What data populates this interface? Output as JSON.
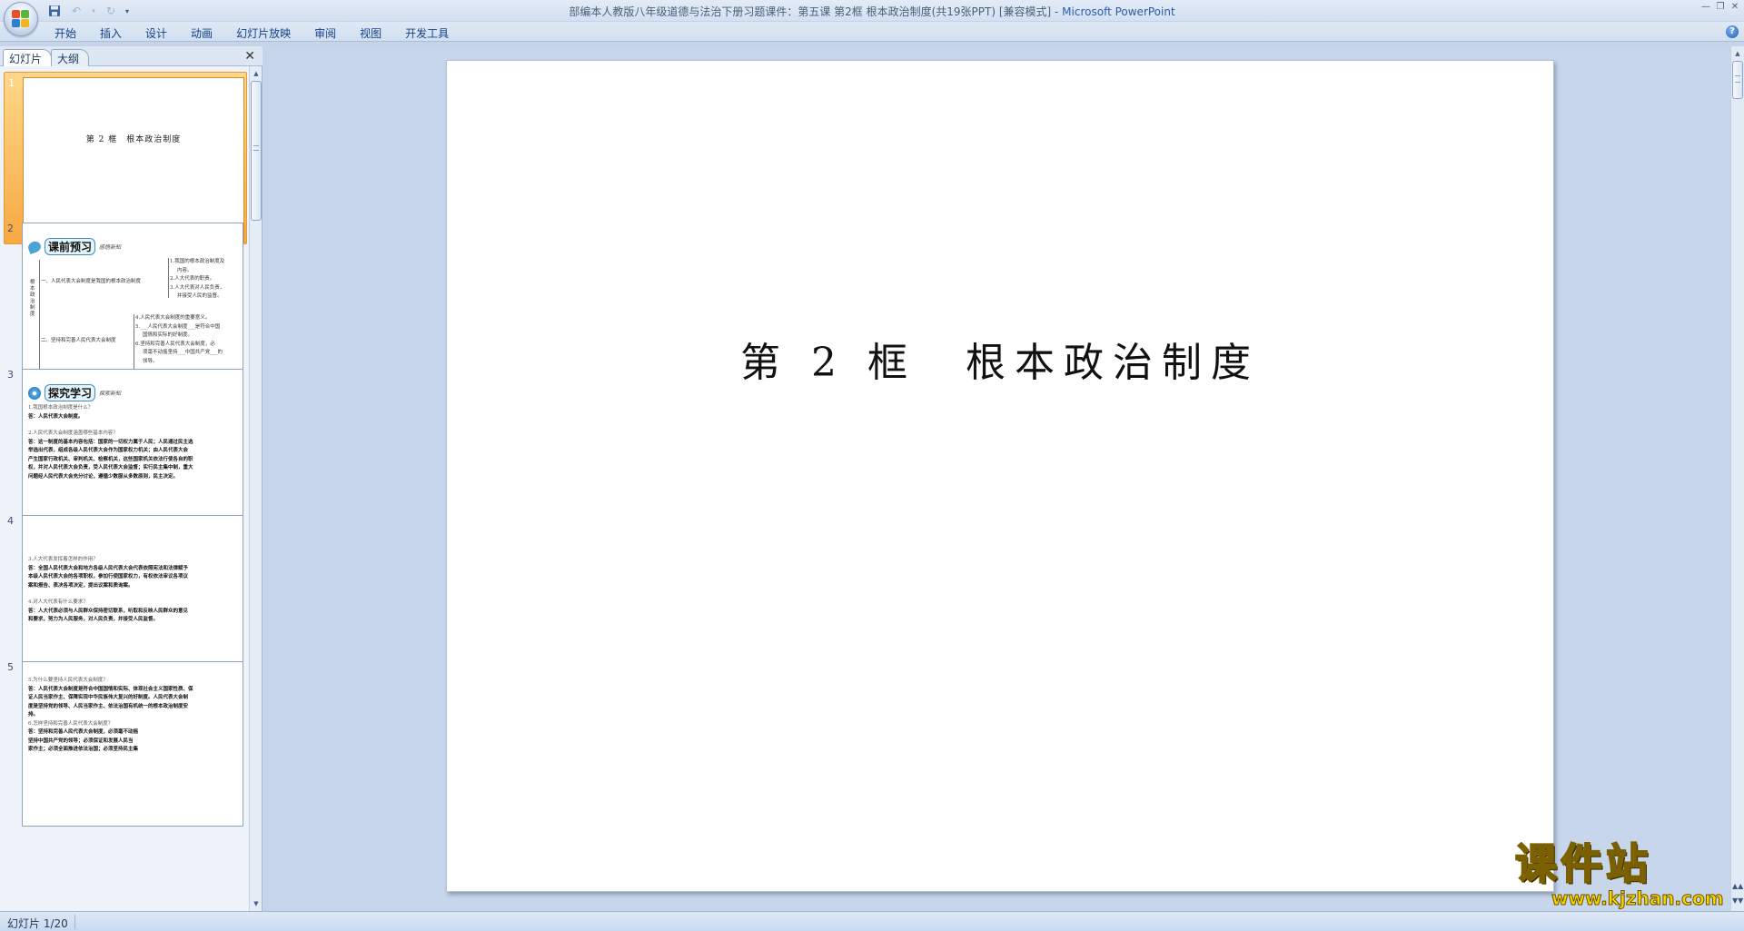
{
  "window": {
    "title": "部编本人教版八年级道德与法治下册习题课件：第五课 第2框 根本政治制度(共19张PPT) [兼容模式]",
    "app_name": "Microsoft PowerPoint",
    "separator": " - "
  },
  "ribbon": {
    "tabs": [
      "开始",
      "插入",
      "设计",
      "动画",
      "幻灯片放映",
      "审阅",
      "视图",
      "开发工具"
    ]
  },
  "pane": {
    "tabs": [
      "幻灯片",
      "大纲"
    ],
    "active_tab": 0
  },
  "thumbnails": [
    {
      "number": "1",
      "title": "第 2 框　根本政治制度"
    },
    {
      "number": "2",
      "header": "课前预习",
      "header_tag": "感悟新知",
      "side_label": "根本政治制度",
      "branches": [
        "一、人民代表大会制度是我国的根本政治制度",
        "二、坚持和完善人民代表大会制度"
      ],
      "items": [
        "1.我国的根本政治制度及",
        "内容。",
        "2.人大代表的职责。",
        "3.人大代表对人民负责，",
        "并接受人民的监督。",
        "4.人民代表大会制度的重要意义。",
        "5.___人民代表大会制度___是符合中国",
        "国情和实际的好制度。",
        "6.坚持和完善人民代表大会制度，必",
        "须毫不动摇坚持___中国共产党___的",
        "领导。"
      ]
    },
    {
      "number": "3",
      "header": "探究学习",
      "header_tag": "探索新知",
      "lines": [
        {
          "kind": "q",
          "text": "1.我国根本政治制度是什么？"
        },
        {
          "kind": "a",
          "text": "答：人民代表大会制度。"
        },
        {
          "kind": "gap",
          "text": ""
        },
        {
          "kind": "q",
          "text": "2.人民代表大会制度涵盖哪些基本内容？"
        },
        {
          "kind": "a",
          "text": "答：这一制度的基本内容包括：国家的一切权力属于人民；人民通过民主选"
        },
        {
          "kind": "a",
          "text": "举选出代表，组成各级人民代表大会作为国家权力机关；由人民代表大会"
        },
        {
          "kind": "a",
          "text": "产生国家行政机关、审判机关、检察机关，这些国家机关依法行使各自的职"
        },
        {
          "kind": "a",
          "text": "权，并对人民代表大会负责，受人民代表大会监督；实行民主集中制，重大"
        },
        {
          "kind": "a",
          "text": "问题经人民代表大会充分讨论，遵循少数服从多数原则，民主决定。"
        }
      ]
    },
    {
      "number": "4",
      "lines": [
        {
          "kind": "q",
          "text": "3.人大代表发挥着怎样的作用？"
        },
        {
          "kind": "a",
          "text": "答：全国人民代表大会和地方各级人民代表大会代表依照宪法和法律赋予"
        },
        {
          "kind": "a",
          "text": "本级人民代表大会的各项职权，参加行使国家权力，有权依法审议各项议"
        },
        {
          "kind": "a",
          "text": "案和报告、表决各项决定，提出议案和质询案。"
        },
        {
          "kind": "gap",
          "text": ""
        },
        {
          "kind": "q",
          "text": "4.对人大代表有什么要求？"
        },
        {
          "kind": "a",
          "text": "答：人大代表必须与人民群众保持密切联系，听取和反映人民群众的意见"
        },
        {
          "kind": "a",
          "text": "和要求，努力为人民服务，对人民负责，并接受人民监督。"
        }
      ]
    },
    {
      "number": "5",
      "lines": [
        {
          "kind": "q",
          "text": "5.为什么要坚持人民代表大会制度？"
        },
        {
          "kind": "a",
          "text": "答：人民代表大会制度是符合中国国情和实际、体现社会主义国家性质、保"
        },
        {
          "kind": "a",
          "text": "证人民当家作主、保障实现中华民族伟大复兴的好制度。人民代表大会制"
        },
        {
          "kind": "a",
          "text": "度是坚持党的领导、人民当家作主、依法治国有机统一的根本政治制度安"
        },
        {
          "kind": "a",
          "text": "排。"
        },
        {
          "kind": "q",
          "text": "6.怎样坚持和完善人民代表大会制度？"
        },
        {
          "kind": "a",
          "text": "答：坚持和完善人民代表大会制度，必须毫不动摇"
        },
        {
          "kind": "a",
          "text": "坚持中国共产党的领导；必须保证和发展人民当"
        },
        {
          "kind": "a",
          "text": "家作主；必须全面推进依法治国；必须坚持民主集"
        }
      ]
    }
  ],
  "slide": {
    "title": "第 2 框　根本政治制度"
  },
  "watermark": {
    "brand": "课件站",
    "url": "www.kjzhan.com"
  },
  "status": {
    "slide_indicator": "幻灯片 1/20"
  }
}
